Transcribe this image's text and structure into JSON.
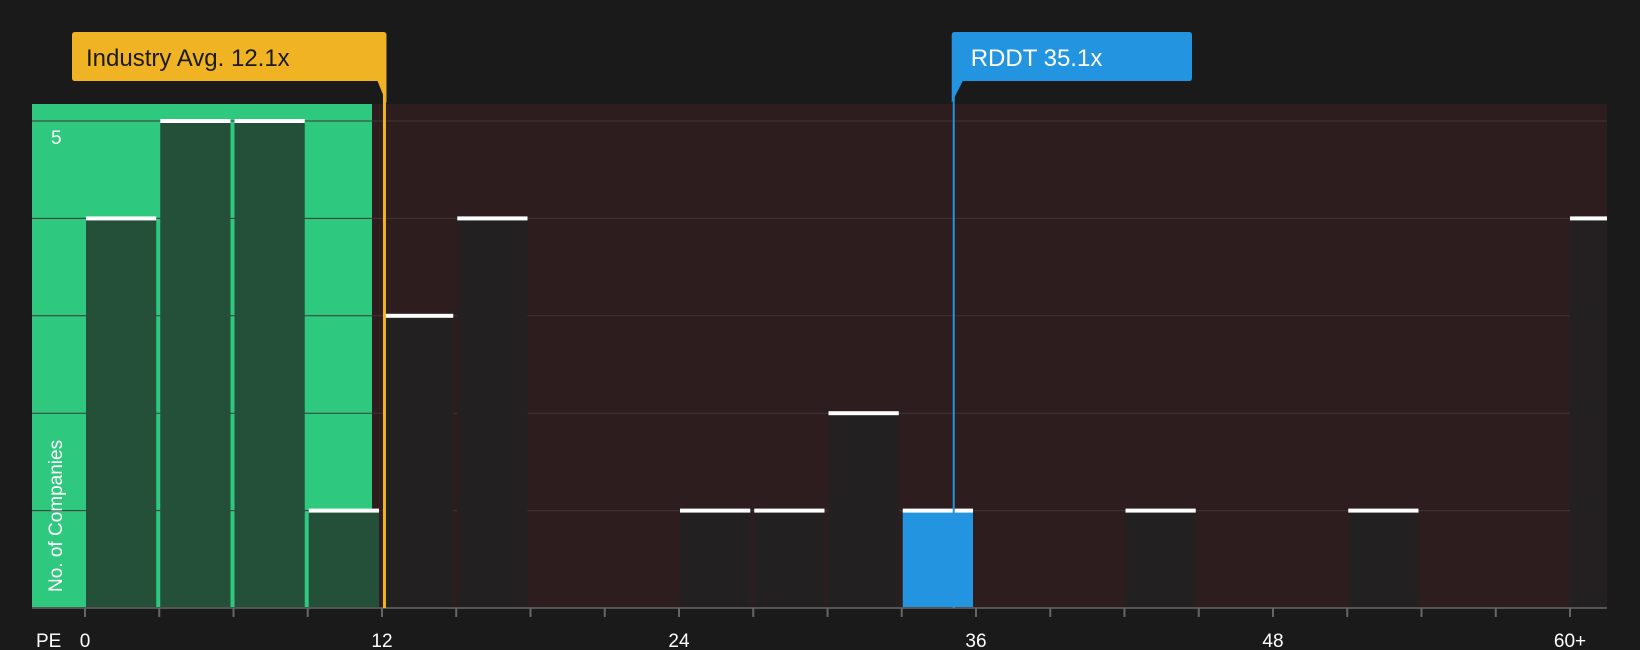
{
  "chart_data": {
    "type": "bar",
    "x_axis_label": "PE",
    "y_axis_label": "No. of Companies",
    "x_ticks": [
      "0",
      "12",
      "24",
      "36",
      "48",
      "60+"
    ],
    "x_tick_values": [
      0,
      12,
      24,
      36,
      48,
      60
    ],
    "y_tick_label": "5",
    "y_tick_value": 5,
    "ylim": [
      0,
      5
    ],
    "bin_width": 3,
    "bins": [
      {
        "start": 0,
        "value": 4
      },
      {
        "start": 3,
        "value": 5
      },
      {
        "start": 6,
        "value": 5
      },
      {
        "start": 9,
        "value": 1
      },
      {
        "start": 12,
        "value": 3
      },
      {
        "start": 15,
        "value": 4
      },
      {
        "start": 24,
        "value": 1
      },
      {
        "start": 27,
        "value": 1
      },
      {
        "start": 30,
        "value": 2
      },
      {
        "start": 33,
        "value": 1,
        "highlight": true
      },
      {
        "start": 42,
        "value": 1
      },
      {
        "start": 51,
        "value": 1
      },
      {
        "start": 60,
        "value": 4
      }
    ],
    "industry_avg": {
      "label": "Industry Avg. 12.1x",
      "value": 12.1
    },
    "company": {
      "label": "RDDT 35.1x",
      "value": 35.1
    },
    "colors": {
      "background": "#1a1a1a",
      "fair_zone": "#2ec97e",
      "expensive_zone": "#2e1d1e",
      "bar_in_zone": "#24503a",
      "bar": "#222020",
      "highlight": "#2394e0",
      "industry_callout": "#f0b323",
      "company_callout": "#2394e0",
      "bar_top": "#ffffff",
      "grid": "#3e3536"
    }
  }
}
